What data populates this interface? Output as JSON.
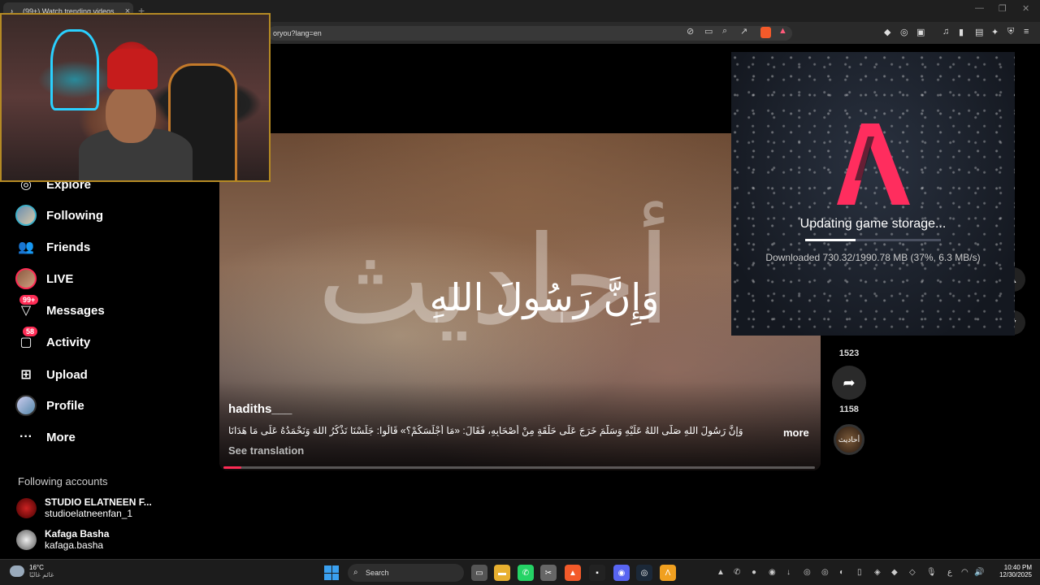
{
  "browser": {
    "tab_title": "(99+) Watch trending videos",
    "tab_close": "×",
    "new_tab": "+",
    "url": "oryou?lang=en",
    "window_controls": [
      "—",
      "❐",
      "✕"
    ]
  },
  "sidebar": {
    "items": [
      {
        "label": "Explore",
        "icon": "compass-icon",
        "badge": ""
      },
      {
        "label": "Following",
        "icon": "following-avatar",
        "badge": ""
      },
      {
        "label": "Friends",
        "icon": "friends-icon",
        "badge": ""
      },
      {
        "label": "LIVE",
        "icon": "live-avatar",
        "badge": ""
      },
      {
        "label": "Messages",
        "icon": "messages-icon",
        "badge": "99+"
      },
      {
        "label": "Activity",
        "icon": "activity-icon",
        "badge": "58"
      },
      {
        "label": "Upload",
        "icon": "upload-icon",
        "badge": ""
      },
      {
        "label": "Profile",
        "icon": "profile-avatar",
        "badge": ""
      },
      {
        "label": "More",
        "icon": "more-icon",
        "badge": ""
      }
    ],
    "following_title": "Following accounts",
    "accounts": [
      {
        "name": "STUDIO ELATNEEN F...",
        "handle": "studioelatneenfan_1"
      },
      {
        "name": "Kafaga Basha",
        "handle": "kafaga.basha"
      }
    ]
  },
  "video": {
    "overlay_text": "وَإِنَّ رَسُولَ اللهِ",
    "overlay_big": "أحاديث",
    "author": "hadiths___",
    "caption": "وَإِنَّ رَسُولَ اللهِ صَلَّى اللهُ عَلَيْهِ وَسَلَّمَ خَرَجَ عَلَى حَلْقَةٍ مِنْ أَصْحَابِهِ، فَقَالَ: «مَا أَجْلَسَكُمْ؟» قَالُوا: جَلَسْنَا نَذْكُرُ اللهَ وَنَحْمَدُهُ عَلَى مَا هَدَانَا",
    "more_label": "more",
    "translate_label": "See translation",
    "progress": 0.03
  },
  "actions": {
    "like_count": "1523",
    "share_count": "1158",
    "share_icon": "share-icon",
    "disc_label": "أحاديث"
  },
  "launcher": {
    "status": "Updating game storage...",
    "detail": "Downloaded 730.32/1990.78 MB (37%, 6.3 MB/s)",
    "progress": 0.37,
    "accent": "#ff2d5e"
  },
  "taskbar": {
    "temperature": "16°C",
    "weather_desc": "غائم غالبًا",
    "search_label": "Search",
    "time": "10:40 PM",
    "date": "12/30/2025",
    "lang": "ع"
  }
}
